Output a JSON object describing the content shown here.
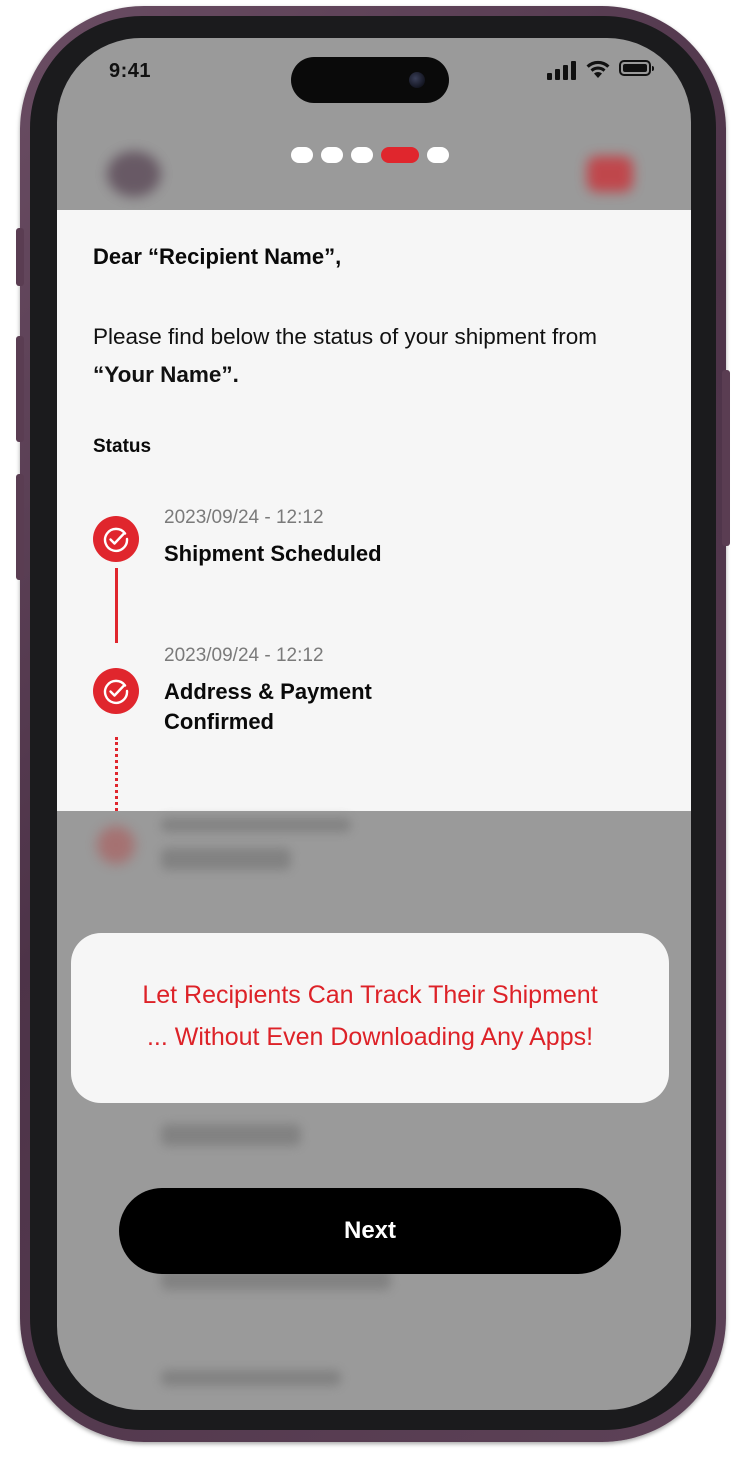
{
  "status_bar": {
    "time": "9:41"
  },
  "onboarding": {
    "page_count": 5,
    "active_page": 4
  },
  "card": {
    "greeting": "Dear “Recipient Name”,",
    "intro_text": "Please find below the status of your shipment from ",
    "intro_name": "“Your Name”.",
    "status_heading": "Status",
    "events": [
      {
        "timestamp": "2023/09/24 - 12:12",
        "title": "Shipment Scheduled"
      },
      {
        "timestamp": "2023/09/24 - 12:12",
        "title_line1": "Address & Payment",
        "title_line2": "Confirmed"
      }
    ]
  },
  "promo": {
    "line1": "Let Recipients Can Track Their Shipment",
    "line2": "... Without Even Downloading Any Apps!"
  },
  "next_button": {
    "label": "Next"
  },
  "colors": {
    "accent": "#e0262d",
    "frame": "#5a3d52",
    "overlay": "#9a9a9a",
    "card": "#f6f6f6"
  },
  "icons": [
    "signal-icon",
    "wifi-icon",
    "battery-icon",
    "check-circle-icon"
  ]
}
